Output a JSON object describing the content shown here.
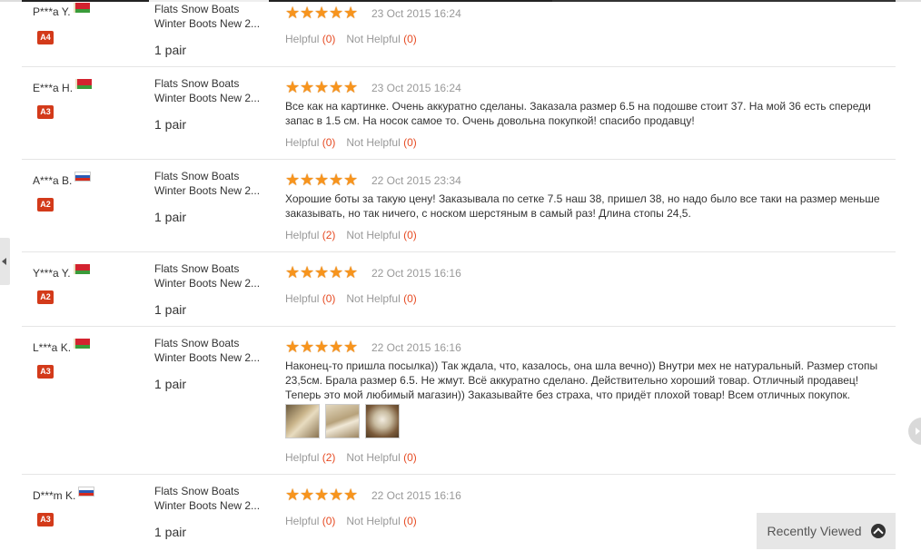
{
  "reviews": [
    {
      "buyer": "P***a Y.",
      "flag": "by",
      "level": "A4",
      "product_line1": "Flats Snow Boats",
      "product_line2": "Winter Boots New 2...",
      "qty": "1 pair",
      "date": "23 Oct 2015 16:24",
      "text": "",
      "helpful_label": "Helpful",
      "helpful_count": "(0)",
      "not_helpful_label": "Not Helpful",
      "not_helpful_count": "(0)",
      "rating": 5
    },
    {
      "buyer": "E***a H.",
      "flag": "by",
      "level": "A3",
      "product_line1": "Flats Snow Boats",
      "product_line2": "Winter Boots New 2...",
      "qty": "1 pair",
      "date": "23 Oct 2015 16:24",
      "text": "Все как на картинке. Очень аккуратно сделаны. Заказала размер 6.5 на подошве стоит 37. На мой 36 есть спереди запас в 1.5 см. На носок самое то. Очень довольна покупкой! спасибо продавцу!",
      "helpful_label": "Helpful",
      "helpful_count": "(0)",
      "not_helpful_label": "Not Helpful",
      "not_helpful_count": "(0)",
      "rating": 5
    },
    {
      "buyer": "A***a B.",
      "flag": "ru",
      "level": "A2",
      "product_line1": "Flats Snow Boats",
      "product_line2": "Winter Boots New 2...",
      "qty": "1 pair",
      "date": "22 Oct 2015 23:34",
      "text": "Хорошие боты за такую цену! Заказывала по сетке 7.5 наш 38, пришел 38, но надо было все таки на размер меньше заказывать, но так ничего, с носком шерстяным в самый раз! Длина стопы 24,5.",
      "helpful_label": "Helpful",
      "helpful_count": "(2)",
      "not_helpful_label": "Not Helpful",
      "not_helpful_count": "(0)",
      "rating": 5
    },
    {
      "buyer": "Y***a Y.",
      "flag": "by",
      "level": "A2",
      "product_line1": "Flats Snow Boats",
      "product_line2": "Winter Boots New 2...",
      "qty": "1 pair",
      "date": "22 Oct 2015 16:16",
      "text": "",
      "helpful_label": "Helpful",
      "helpful_count": "(0)",
      "not_helpful_label": "Not Helpful",
      "not_helpful_count": "(0)",
      "rating": 5
    },
    {
      "buyer": "L***a K.",
      "flag": "by",
      "level": "A3",
      "product_line1": "Flats Snow Boats",
      "product_line2": "Winter Boots New 2...",
      "qty": "1 pair",
      "date": "22 Oct 2015 16:16",
      "text": "Наконец-то пришла посылка)) Так ждала, что, казалось, она шла вечно)) Внутри мех не натуральный. Размер стопы 23,5см. Брала размер 6.5. Не жмут. Всё аккуратно сделано. Действительно хороший товар. Отличный продавец! Теперь это мой любимый магазин)) Заказывайте без страха, что придёт плохой товар! Всем отличных покупок.",
      "helpful_label": "Helpful",
      "helpful_count": "(2)",
      "not_helpful_label": "Not Helpful",
      "not_helpful_count": "(0)",
      "rating": 5
    },
    {
      "buyer": "D***m K.",
      "flag": "ru",
      "level": "A3",
      "product_line1": "Flats Snow Boats",
      "product_line2": "Winter Boots New 2...",
      "qty": "1 pair",
      "date": "22 Oct 2015 16:16",
      "text": "",
      "helpful_label": "Helpful",
      "helpful_count": "(0)",
      "not_helpful_label": "Not Helpful",
      "not_helpful_count": "(0)",
      "rating": 5
    }
  ],
  "recently_viewed": {
    "label": "Recently Viewed"
  },
  "colors": {
    "star": "#f7941d",
    "badge": "#d33a1a",
    "count": "#e64b23"
  },
  "icons": {
    "star": "star-icon",
    "flag_by": "flag-belarus-icon",
    "flag_ru": "flag-russia-icon",
    "up": "chevron-up-icon",
    "left": "chevron-left-icon",
    "right": "chevron-right-icon"
  }
}
